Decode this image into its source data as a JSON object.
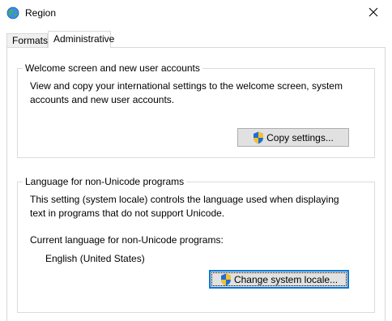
{
  "window": {
    "title": "Region",
    "icon": "globe-icon",
    "close_icon": "close-icon"
  },
  "tabs": [
    {
      "label": "Formats",
      "selected": false
    },
    {
      "label": "Administrative",
      "selected": true
    }
  ],
  "welcome_group": {
    "title": "Welcome screen and new user accounts",
    "description_line1": "View and copy your international settings to the welcome screen, system",
    "description_line2": "accounts and new user accounts.",
    "button_label": "Copy settings...",
    "button_icon": "shield-icon"
  },
  "unicode_group": {
    "title": "Language for non-Unicode programs",
    "description_line1": "This setting (system locale) controls the language used when displaying",
    "description_line2": "text in programs that do not support Unicode.",
    "current_label": "Current language for non-Unicode programs:",
    "current_value": "English (United States)",
    "button_label": "Change system locale...",
    "button_icon": "shield-icon"
  },
  "colors": {
    "accent": "#0078d7",
    "button_bg": "#e1e1e1",
    "border": "#d9d9d9"
  }
}
